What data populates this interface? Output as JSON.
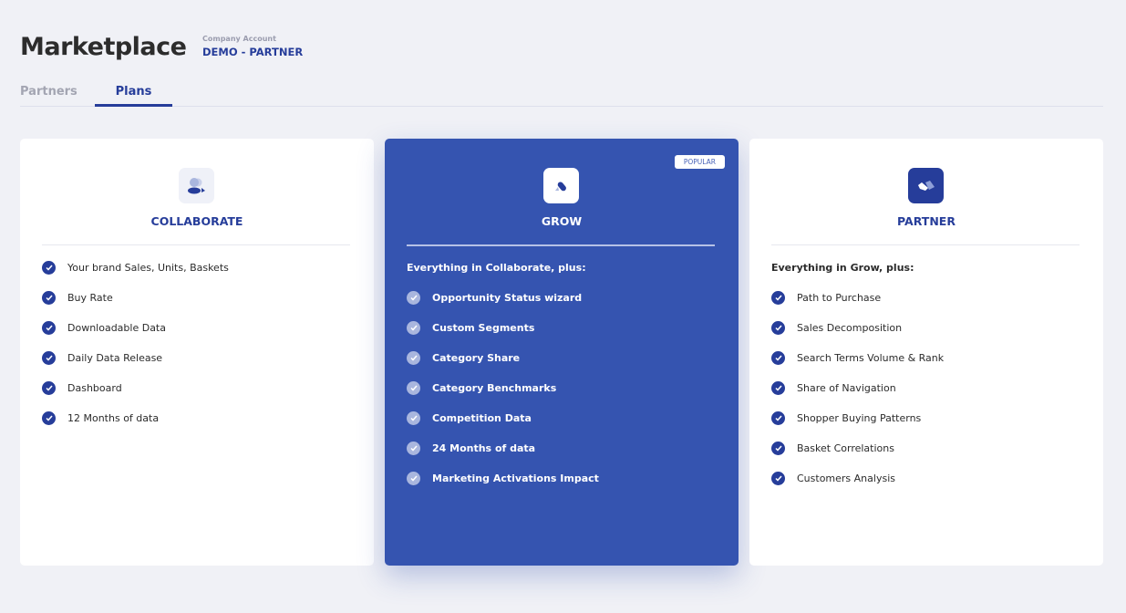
{
  "header": {
    "title": "Marketplace",
    "account_label": "Company Account",
    "account_value": "DEMO - PARTNER"
  },
  "tabs": [
    {
      "label": "Partners",
      "active": false
    },
    {
      "label": "Plans",
      "active": true
    }
  ],
  "plans": [
    {
      "name": "COLLABORATE",
      "icon": "users-icon",
      "intro": null,
      "items": [
        "Your brand Sales, Units, Baskets",
        "Buy Rate",
        "Downloadable Data",
        "Daily Data Release",
        "Dashboard",
        "12 Months of data"
      ]
    },
    {
      "name": "GROW",
      "icon": "grow-icon",
      "badge": "POPULAR",
      "intro": "Everything in Collaborate, plus:",
      "items": [
        "Opportunity Status wizard",
        "Custom Segments",
        "Category Share",
        "Category Benchmarks",
        "Competition Data",
        "24 Months of data",
        "Marketing Activations Impact"
      ]
    },
    {
      "name": "PARTNER",
      "icon": "handshake-icon",
      "intro": "Everything in Grow, plus:",
      "items": [
        "Path to Purchase",
        "Sales Decomposition",
        "Search Terms Volume & Rank",
        "Share of Navigation",
        "Shopper Buying Patterns",
        "Basket Correlations",
        "Customers Analysis"
      ]
    }
  ],
  "colors": {
    "accent": "#263d9a",
    "featured": "#3554b0",
    "background": "#f0f1f6"
  }
}
